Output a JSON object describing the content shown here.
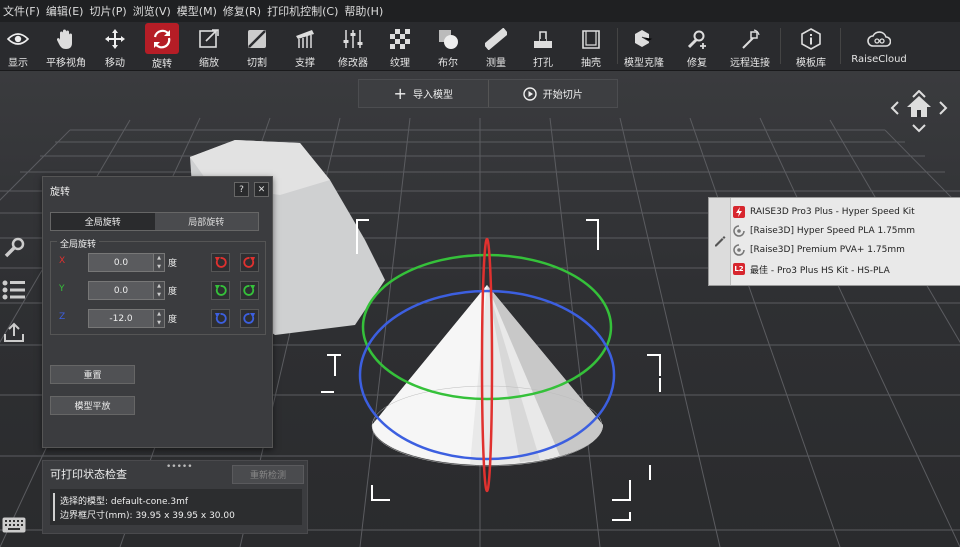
{
  "menu": [
    {
      "id": "file",
      "label": "文件(F)"
    },
    {
      "id": "edit",
      "label": "编辑(E)"
    },
    {
      "id": "slice",
      "label": "切片(P)"
    },
    {
      "id": "view",
      "label": "浏览(V)"
    },
    {
      "id": "model",
      "label": "模型(M)"
    },
    {
      "id": "repair",
      "label": "修复(R)"
    },
    {
      "id": "printer-control",
      "label": "打印机控制(C)"
    },
    {
      "id": "help",
      "label": "帮助(H)"
    }
  ],
  "toolbar": {
    "display": "显示",
    "pan": "平移视角",
    "move": "移动",
    "rotate": "旋转",
    "scale": "缩放",
    "cut": "切割",
    "support": "支撑",
    "modifier": "修改器",
    "texture": "纹理",
    "boolean": "布尔",
    "measure": "测量",
    "hole": "打孔",
    "shell": "抽壳",
    "clone": "模型克隆",
    "repair": "修复",
    "remote": "远程连接",
    "library": "模板库",
    "cloud": "RaiseCloud"
  },
  "top_actions": {
    "import": "导入模型",
    "slice": "开始切片"
  },
  "rotate_panel": {
    "title": "旋转",
    "help": "?",
    "close": "✕",
    "tab_global": "全局旋转",
    "tab_local": "局部旋转",
    "group": "全局旋转",
    "unit": "度",
    "x_label": "X",
    "y_label": "Y",
    "z_label": "Z",
    "x_value": "0.0",
    "y_value": "0.0",
    "z_value": "-12.0",
    "reset": "重置",
    "lay_flat": "模型平放",
    "colors": {
      "x": "#e0312f",
      "y": "#35c13a",
      "z": "#3c5fe0"
    }
  },
  "check_panel": {
    "title": "可打印状态检查",
    "recheck": "重新检测",
    "grip": "•••••",
    "line1": "选择的模型: default-cone.3mf",
    "line2": "边界框尺寸(mm): 39.95 x 39.95 x 30.00"
  },
  "profile": {
    "items": [
      {
        "label": "RAISE3D Pro3 Plus - Hyper Speed Kit",
        "icon": "lightning-icon"
      },
      {
        "label": "[Raise3D] Hyper Speed PLA 1.75mm",
        "icon": "filament-icon"
      },
      {
        "label": "[Raise3D] Premium PVA+ 1.75mm",
        "icon": "filament-icon"
      },
      {
        "label": "最佳 - Pro3 Plus HS Kit - HS-PLA",
        "icon": "l2-icon",
        "badge": "L2"
      }
    ]
  }
}
